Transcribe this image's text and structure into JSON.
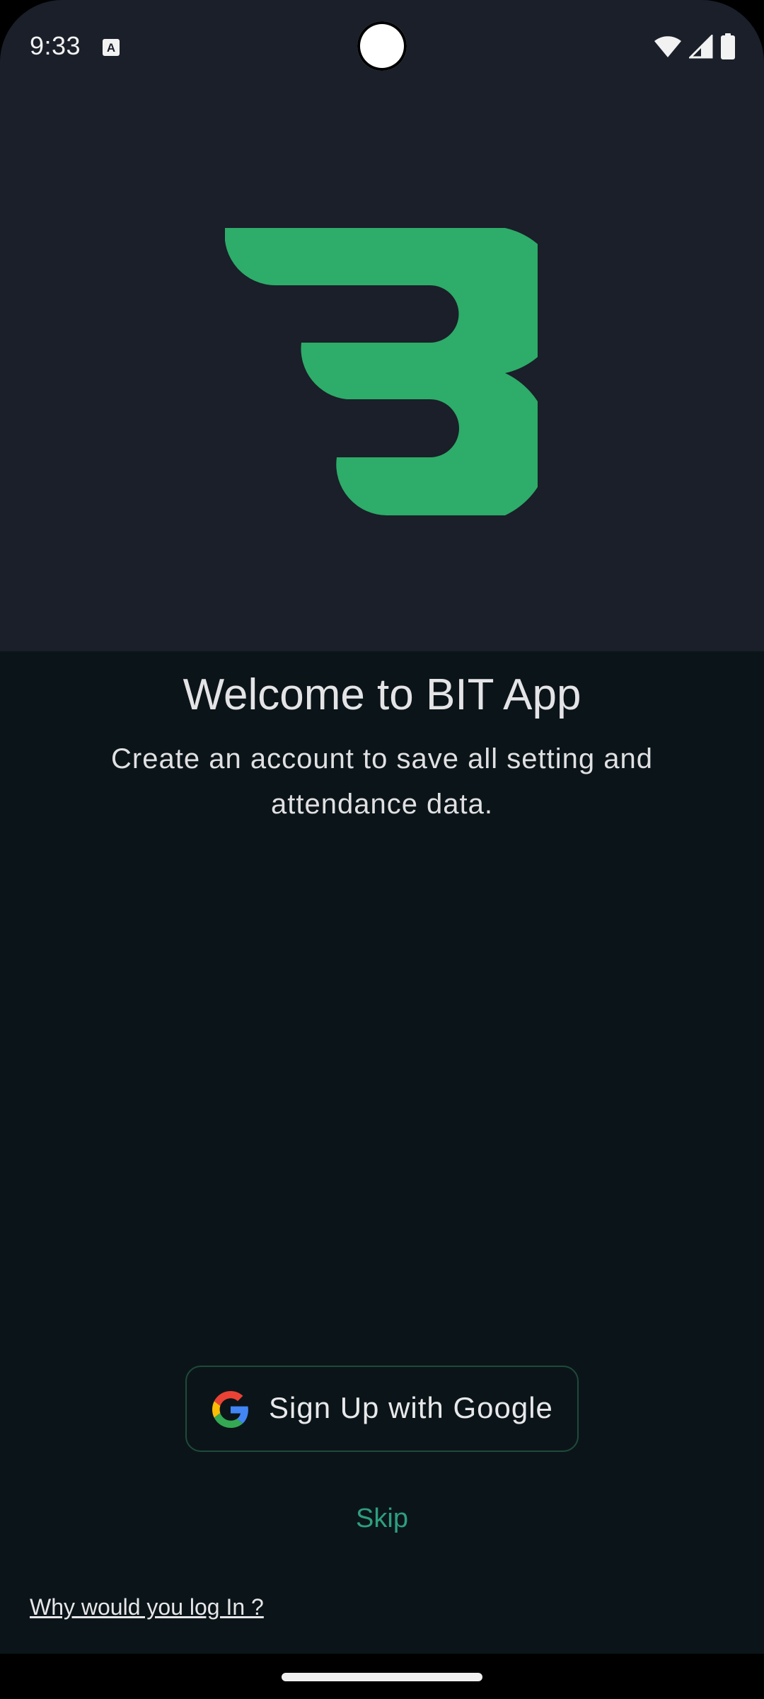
{
  "status_bar": {
    "time": "9:33",
    "icons": [
      "text-notification-icon",
      "wifi-icon",
      "cell-signal-icon",
      "battery-icon"
    ]
  },
  "logo": {
    "icon": "bit-logo-icon",
    "color": "#2eac69"
  },
  "welcome": {
    "title": "Welcome to BIT App",
    "subtitle": "Create an account to save all setting and attendance data."
  },
  "actions": {
    "google_button_label": "Sign Up with Google",
    "google_icon": "google-g-icon",
    "skip_label": "Skip",
    "why_link": "Why would you log In ?"
  },
  "colors": {
    "hero_background": "#1a1f29",
    "background": "#0b1519",
    "accent": "#2e9e7e",
    "logo_green": "#2eac69"
  }
}
